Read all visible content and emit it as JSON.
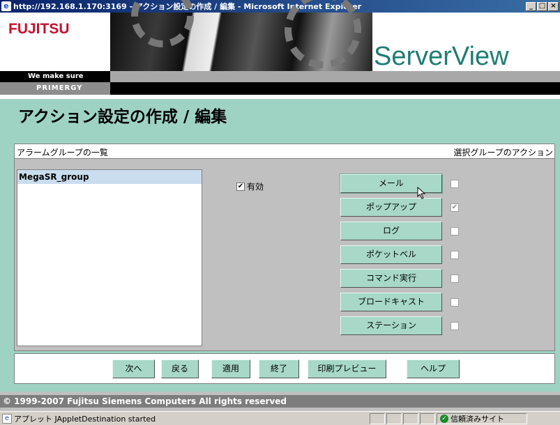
{
  "window": {
    "title": "http://192.168.1.170:3169 - アクション設定の作成 / 編集 - Microsoft Internet Explorer",
    "minimize": "_",
    "maximize": "□",
    "close": "×"
  },
  "header": {
    "logo": "FUJITSU",
    "brand": "ServerView",
    "tagline": "We make sure",
    "product": "PRIMERGY"
  },
  "page": {
    "title": "アクション設定の作成 / 編集"
  },
  "panel": {
    "left_header": "アラームグループの一覧",
    "right_header": "選択グループのアクション",
    "groups": [
      "MegaSR_group"
    ],
    "enable_label": "有効",
    "enable_checked": true,
    "actions": [
      {
        "label": "メール",
        "checked": false
      },
      {
        "label": "ポップアップ",
        "checked": true
      },
      {
        "label": "ログ",
        "checked": false
      },
      {
        "label": "ポケットベル",
        "checked": false
      },
      {
        "label": "コマンド実行",
        "checked": false
      },
      {
        "label": "ブロードキャスト",
        "checked": false
      },
      {
        "label": "ステーション",
        "checked": false
      }
    ]
  },
  "buttons": {
    "next": "次へ",
    "back": "戻る",
    "apply": "適用",
    "finish": "終了",
    "print_preview": "印刷プレビュー",
    "help": "ヘルプ"
  },
  "footer": {
    "copyright": "© 1999-2007 Fujitsu Siemens Computers All rights reserved"
  },
  "statusbar": {
    "text": "アプレット JAppletDestination started",
    "zone": "信頼済みサイト"
  },
  "colors": {
    "brand_teal": "#1e7d73",
    "logo_red": "#c8102e",
    "main_bg": "#9ed3c4",
    "button_face": "#a7d8c8"
  }
}
